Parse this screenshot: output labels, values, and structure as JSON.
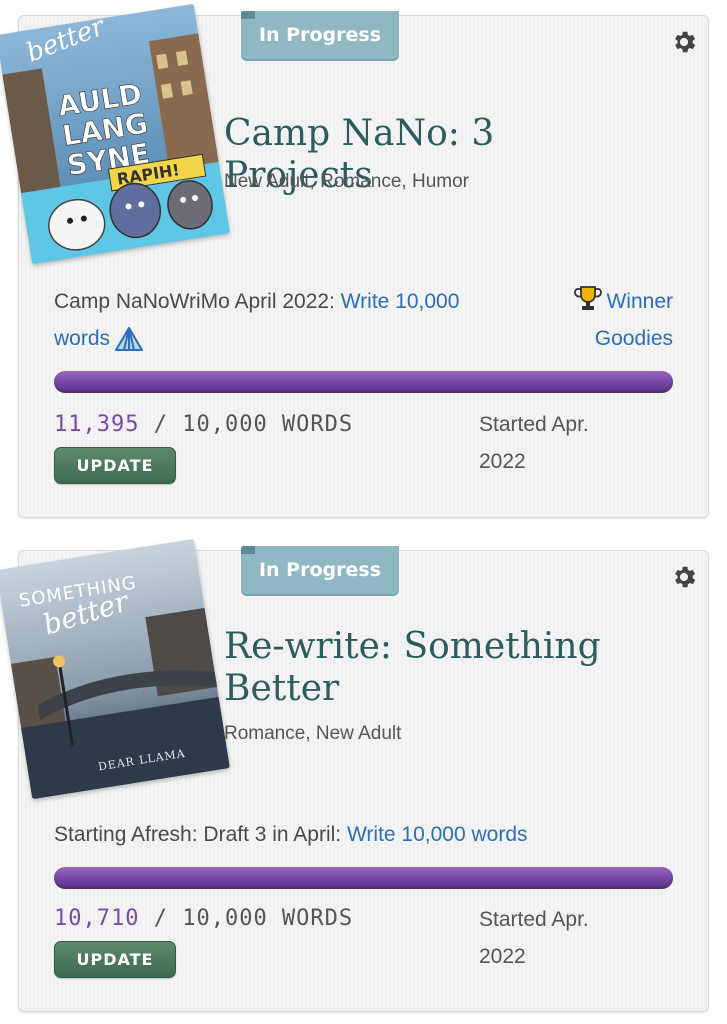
{
  "projects": [
    {
      "status": "In Progress",
      "title": "Camp NaNo: 3 Projects",
      "genres": "New Adult, Romance, Humor",
      "cover": {
        "script_text": "better",
        "title_lines": [
          "AULD",
          "LANG",
          "SYNE"
        ],
        "banner": "RAPIH!"
      },
      "goal_prefix": "Camp NaNoWriMo April 2022: ",
      "goal_link": "Write 10,000 words",
      "winner_line1": "Winner",
      "winner_line2": "Goodies",
      "progress": 1.0,
      "current_words": "11,395",
      "target_words": " / 10,000 WORDS",
      "update_label": "UPDATE",
      "started": "Started Apr. 2022"
    },
    {
      "status": "In Progress",
      "title": "Re-write: Something Better",
      "genres": "Romance, New Adult",
      "cover": {
        "title_text": "SOMETHING",
        "script_text": "better",
        "author": "DEAR LLAMA"
      },
      "goal_prefix": "Starting Afresh: Draft 3 in April: ",
      "goal_link": "Write 10,000 words",
      "progress": 1.0,
      "current_words": "10,710",
      "target_words": " / 10,000 WORDS",
      "update_label": "UPDATE",
      "started": "Started Apr. 2022"
    }
  ],
  "colors": {
    "title": "#2d5c5e",
    "link": "#2a6fb8",
    "progress": "#7a4aa8",
    "status_tab": "#8fb8c4",
    "update_button": "#3d6a52"
  }
}
